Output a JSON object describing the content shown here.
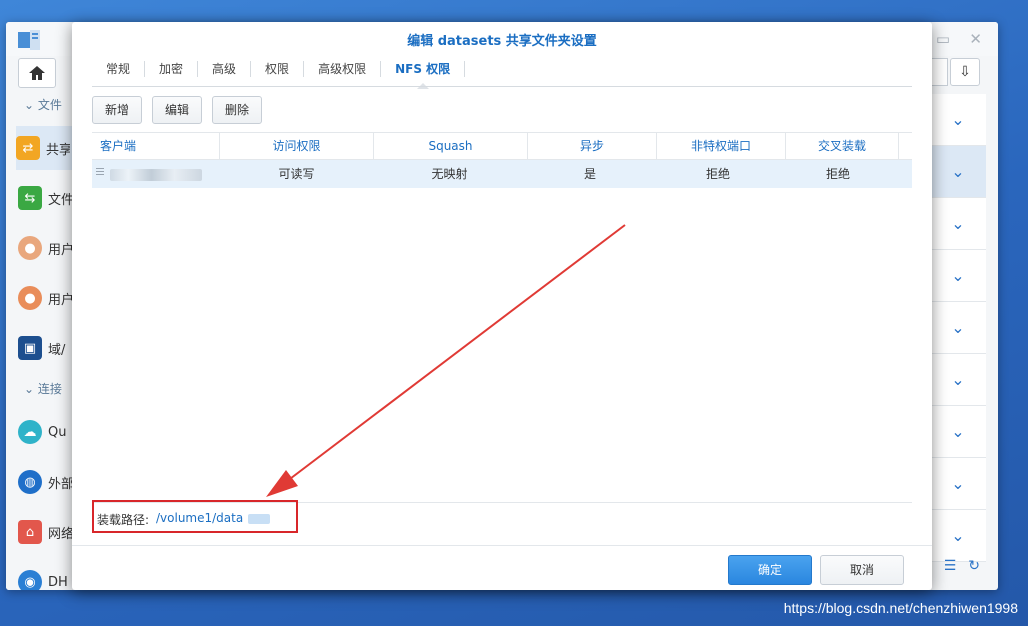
{
  "dialog": {
    "title": "编辑 datasets 共享文件夹设置",
    "tabs": [
      "常规",
      "加密",
      "高级",
      "权限",
      "高级权限",
      "NFS 权限"
    ],
    "active_tab": "NFS 权限",
    "buttons": {
      "add": "新增",
      "edit": "编辑",
      "delete": "删除"
    },
    "grid": {
      "columns": [
        "客户端",
        "访问权限",
        "Squash",
        "异步",
        "非特权端口",
        "交叉装载"
      ],
      "rows": [
        {
          "client": "",
          "access": "可读写",
          "squash": "无映射",
          "async": "是",
          "non_priv_port": "拒绝",
          "cross_mount": "拒绝"
        }
      ]
    },
    "mount": {
      "label": "装载路径:",
      "path": "/volume1/data"
    },
    "footer": {
      "ok": "确定",
      "cancel": "取消"
    }
  },
  "background": {
    "sidebar": {
      "group1": "文件",
      "group2": "连接",
      "items": [
        "共享",
        "文件",
        "用户",
        "用户",
        "域/",
        "Qu",
        "外部",
        "网络",
        "DH"
      ]
    }
  },
  "colors": {
    "accent": "#1b6ec2",
    "highlight_box": "#d8262a",
    "desktop": "#2b6fc4"
  },
  "watermark": "https://blog.csdn.net/chenzhiwen1998"
}
